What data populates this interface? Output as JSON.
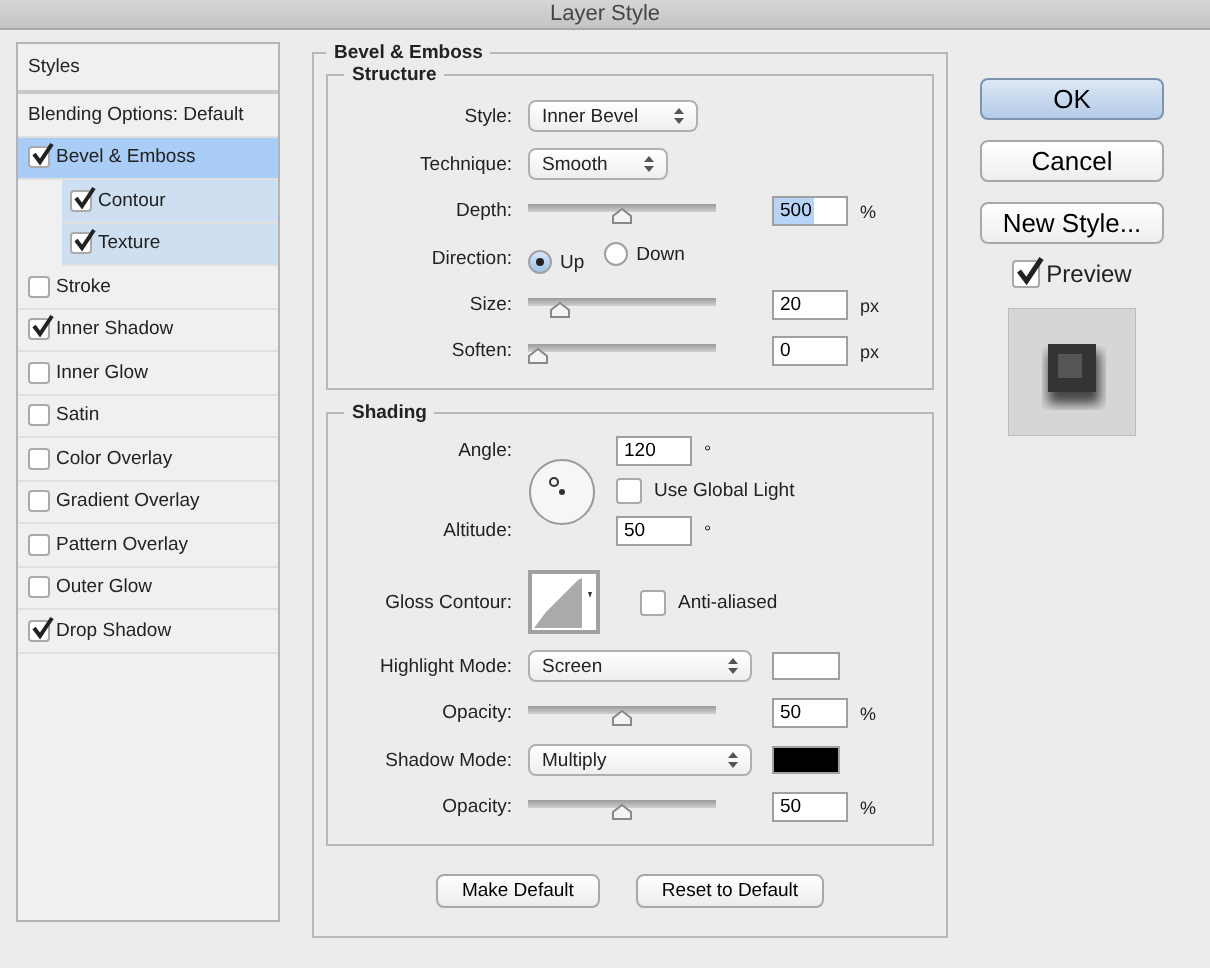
{
  "window": {
    "title": "Layer Style"
  },
  "styles_list": {
    "header": "Styles",
    "items": [
      {
        "label": "Blending Options: Default",
        "kind": "plain",
        "selected": false
      },
      {
        "label": "Bevel & Emboss",
        "kind": "check",
        "checked": true,
        "selected": true,
        "children": [
          {
            "label": "Contour",
            "kind": "check",
            "checked": true,
            "selected": false
          },
          {
            "label": "Texture",
            "kind": "check",
            "checked": true,
            "selected": false
          }
        ]
      },
      {
        "label": "Stroke",
        "kind": "check",
        "checked": false,
        "selected": false
      },
      {
        "label": "Inner Shadow",
        "kind": "check",
        "checked": true,
        "selected": false
      },
      {
        "label": "Inner Glow",
        "kind": "check",
        "checked": false,
        "selected": false
      },
      {
        "label": "Satin",
        "kind": "check",
        "checked": false,
        "selected": false
      },
      {
        "label": "Color Overlay",
        "kind": "check",
        "checked": false,
        "selected": false
      },
      {
        "label": "Gradient Overlay",
        "kind": "check",
        "checked": false,
        "selected": false
      },
      {
        "label": "Pattern Overlay",
        "kind": "check",
        "checked": false,
        "selected": false
      },
      {
        "label": "Outer Glow",
        "kind": "check",
        "checked": false,
        "selected": false
      },
      {
        "label": "Drop Shadow",
        "kind": "check",
        "checked": true,
        "selected": false
      }
    ]
  },
  "panel": {
    "title": "Bevel & Emboss",
    "structure": {
      "title": "Structure",
      "rows": [
        {
          "kind": "select",
          "label": "Style:",
          "value": "Inner Bevel"
        },
        {
          "kind": "select",
          "label": "Technique:",
          "value": "Smooth"
        },
        {
          "kind": "slider",
          "label": "Depth:",
          "level": 0.5,
          "value": "500",
          "unit": "%",
          "text_selected": true
        },
        {
          "kind": "radio",
          "label": "Direction:",
          "options": [
            {
              "label": "Up",
              "selected": true
            },
            {
              "label": "Down",
              "selected": false
            }
          ]
        },
        {
          "kind": "slider",
          "label": "Size:",
          "level": 0.13,
          "value": "20",
          "unit": "px",
          "text_selected": false
        },
        {
          "kind": "slider",
          "label": "Soften:",
          "level": 0,
          "value": "0",
          "unit": "px",
          "text_selected": false
        }
      ]
    },
    "shading": {
      "title": "Shading",
      "angle": {
        "label": "Angle:",
        "value": "120",
        "unit": "°"
      },
      "global_light": {
        "label": "Use Global Light",
        "checked": false
      },
      "altitude": {
        "label": "Altitude:",
        "value": "50",
        "unit": "°"
      },
      "gloss_contour": {
        "label": "Gloss Contour:"
      },
      "anti_aliased": {
        "label": "Anti-aliased",
        "checked": false
      },
      "rows": [
        {
          "kind": "select",
          "label": "Highlight Mode:",
          "value": "Screen",
          "color": "#ffffff"
        },
        {
          "kind": "slider",
          "label": "Opacity:",
          "level": 0.5,
          "value": "50",
          "unit": "%",
          "text_selected": false
        },
        {
          "kind": "select",
          "label": "Shadow Mode:",
          "value": "Multiply",
          "color": "#000000"
        },
        {
          "kind": "slider",
          "label": "Opacity:",
          "level": 0.5,
          "value": "50",
          "unit": "%",
          "text_selected": false
        }
      ]
    },
    "buttons": [
      "Make Default",
      "Reset to Default"
    ]
  },
  "side": {
    "buttons": [
      {
        "label": "OK",
        "default": true
      },
      {
        "label": "Cancel",
        "default": false
      },
      {
        "label": "New Style...",
        "default": false
      }
    ],
    "preview": {
      "label": "Preview",
      "checked": true
    }
  }
}
